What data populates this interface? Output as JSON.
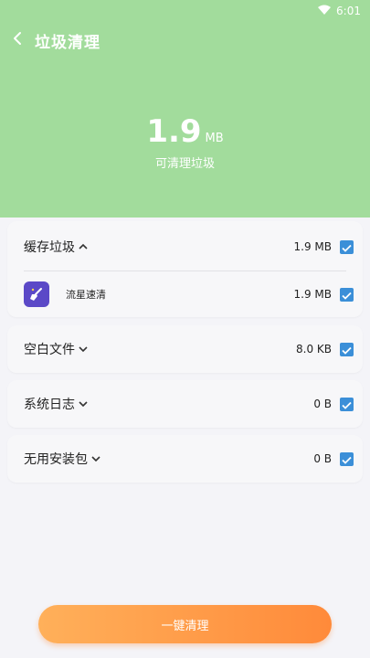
{
  "status_bar": {
    "time": "6:01",
    "wifi_icon": "wifi-icon"
  },
  "header": {
    "title": "垃圾清理",
    "back_icon": "chevron-left-icon",
    "total_size": "1.9",
    "total_unit": "MB",
    "caption": "可清理垃圾"
  },
  "colors": {
    "header_bg": "#a2dc9c",
    "checkbox": "#3b8fd8",
    "button_gradient_start": "#ffb05a",
    "button_gradient_end": "#ff8a3a",
    "app_icon_bg": "#5b49c7"
  },
  "categories": [
    {
      "label": "缓存垃圾",
      "size": "1.9 MB",
      "expanded": true,
      "checked": true,
      "items": [
        {
          "name": "流星速清",
          "size": "1.9 MB",
          "checked": true,
          "icon": "broom-app-icon"
        }
      ]
    },
    {
      "label": "空白文件",
      "size": "8.0 KB",
      "expanded": false,
      "checked": true
    },
    {
      "label": "系统日志",
      "size": "0 B",
      "expanded": false,
      "checked": true
    },
    {
      "label": "无用安装包",
      "size": "0 B",
      "expanded": false,
      "checked": true
    }
  ],
  "action": {
    "clean_label": "一键清理"
  }
}
